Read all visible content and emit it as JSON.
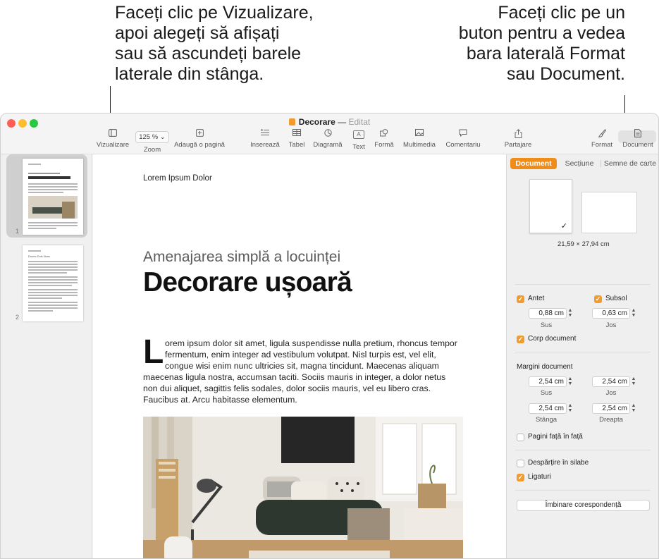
{
  "callouts": {
    "left": [
      "Faceți clic pe Vizualizare,",
      "apoi alegeți să afișați",
      "sau să ascundeți barele",
      "laterale din stânga."
    ],
    "right": [
      "Faceți clic pe un",
      "buton pentru a vedea",
      "bara laterală Format",
      "sau Document."
    ]
  },
  "window": {
    "doc_name": "Decorare",
    "separator": "—",
    "status": "Editat",
    "colors": {
      "close": "#ff5f57",
      "minimize": "#febc2e",
      "zoom": "#28c840",
      "accent": "#f29b2c"
    }
  },
  "toolbar": {
    "view": {
      "label": "Vizualizare",
      "icon": "sidebar-icon"
    },
    "zoom": {
      "label": "Zoom",
      "value": "125 %"
    },
    "add_page": {
      "label": "Adaugă o pagină",
      "icon": "plus-square-icon"
    },
    "insert": {
      "label": "Inserează",
      "icon": "insert-list-icon"
    },
    "table": {
      "label": "Tabel",
      "icon": "table-icon"
    },
    "chart": {
      "label": "Diagramă",
      "icon": "chart-icon"
    },
    "text": {
      "label": "Text",
      "icon": "text-box-icon"
    },
    "shape": {
      "label": "Formă",
      "icon": "shape-icon"
    },
    "media": {
      "label": "Multimedia",
      "icon": "photo-icon"
    },
    "comment": {
      "label": "Comentariu",
      "icon": "comment-icon"
    },
    "share": {
      "label": "Partajare",
      "icon": "share-icon"
    },
    "format": {
      "label": "Format",
      "icon": "paintbrush-icon"
    },
    "document": {
      "label": "Document",
      "icon": "document-icon"
    }
  },
  "pages": {
    "thumb1_number": "1",
    "thumb2_number": "2",
    "thumb2_heading": "Donec Duis Nunc"
  },
  "document": {
    "header": "Lorem Ipsum Dolor",
    "subtitle": "Amenajarea simplă a locuinței",
    "title": "Decorare ușoară",
    "drop_cap": "L",
    "body_lines": [
      "orem ipsum dolor sit amet, ligula suspendisse nulla pretium, rhoncus tempor",
      "fermentum, enim integer ad vestibulum volutpat. Nisl turpis est, vel elit,",
      "congue wisi enim nunc ultricies sit, magna tincidunt. Maecenas aliquam",
      "maecenas ligula nostra, accumsan taciti. Sociis mauris in integer, a dolor netus",
      "non dui aliquet, sagittis felis sodales, dolor sociis mauris, vel eu libero cras.",
      "Faucibus at. Arcu habitasse elementum."
    ]
  },
  "inspector": {
    "tabs": [
      "Document",
      "Secțiune",
      "Semne de carte"
    ],
    "paper_size": "21,59 × 27,94 cm",
    "header_cb": "Antet",
    "footer_cb": "Subsol",
    "header_value": "0,88 cm",
    "footer_value": "0,63 cm",
    "top_label": "Sus",
    "bottom_label": "Jos",
    "body_cb": "Corp document",
    "margins_title": "Margini document",
    "margin_top": "2,54 cm",
    "margin_bottom": "2,54 cm",
    "margin_left": "2,54 cm",
    "margin_right": "2,54 cm",
    "left_label": "Stânga",
    "right_label": "Dreapta",
    "facing_pages": "Pagini față în față",
    "hyphenation": "Despărțire în silabe",
    "ligatures": "Ligaturi",
    "mail_merge": "Îmbinare corespondență"
  }
}
